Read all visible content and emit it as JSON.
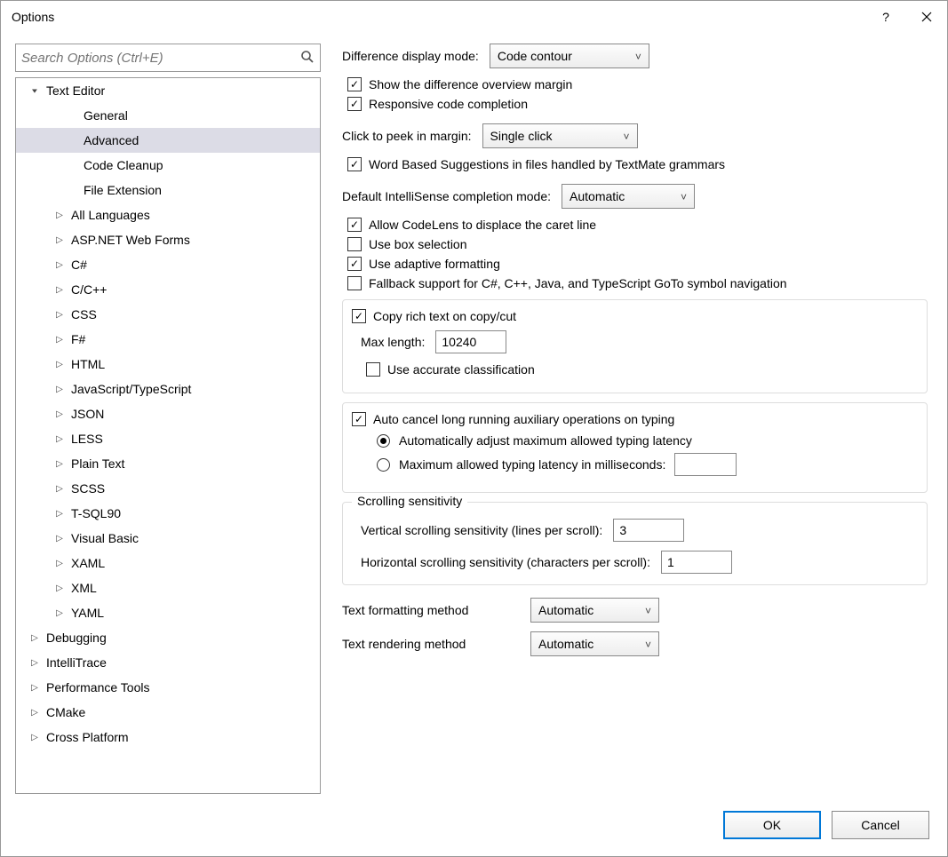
{
  "window": {
    "title": "Options"
  },
  "search": {
    "placeholder": "Search Options (Ctrl+E)"
  },
  "tree": {
    "items": [
      {
        "label": "Text Editor",
        "indent": 0,
        "caret": "open"
      },
      {
        "label": "General",
        "indent": 1,
        "caret": "none"
      },
      {
        "label": "Advanced",
        "indent": 1,
        "caret": "none",
        "selected": true
      },
      {
        "label": "Code Cleanup",
        "indent": 1,
        "caret": "none"
      },
      {
        "label": "File Extension",
        "indent": 1,
        "caret": "none"
      },
      {
        "label": "All Languages",
        "indent": 1,
        "caret": "closed"
      },
      {
        "label": "ASP.NET Web Forms",
        "indent": 1,
        "caret": "closed"
      },
      {
        "label": "C#",
        "indent": 1,
        "caret": "closed"
      },
      {
        "label": "C/C++",
        "indent": 1,
        "caret": "closed"
      },
      {
        "label": "CSS",
        "indent": 1,
        "caret": "closed"
      },
      {
        "label": "F#",
        "indent": 1,
        "caret": "closed"
      },
      {
        "label": "HTML",
        "indent": 1,
        "caret": "closed"
      },
      {
        "label": "JavaScript/TypeScript",
        "indent": 1,
        "caret": "closed"
      },
      {
        "label": "JSON",
        "indent": 1,
        "caret": "closed"
      },
      {
        "label": "LESS",
        "indent": 1,
        "caret": "closed"
      },
      {
        "label": "Plain Text",
        "indent": 1,
        "caret": "closed"
      },
      {
        "label": "SCSS",
        "indent": 1,
        "caret": "closed"
      },
      {
        "label": "T-SQL90",
        "indent": 1,
        "caret": "closed"
      },
      {
        "label": "Visual Basic",
        "indent": 1,
        "caret": "closed"
      },
      {
        "label": "XAML",
        "indent": 1,
        "caret": "closed"
      },
      {
        "label": "XML",
        "indent": 1,
        "caret": "closed"
      },
      {
        "label": "YAML",
        "indent": 1,
        "caret": "closed"
      },
      {
        "label": "Debugging",
        "indent": 0,
        "caret": "closed"
      },
      {
        "label": "IntelliTrace",
        "indent": 0,
        "caret": "closed"
      },
      {
        "label": "Performance Tools",
        "indent": 0,
        "caret": "closed"
      },
      {
        "label": "CMake",
        "indent": 0,
        "caret": "closed"
      },
      {
        "label": "Cross Platform",
        "indent": 0,
        "caret": "closed"
      }
    ]
  },
  "panel": {
    "diff_mode_label": "Difference display mode:",
    "diff_mode_value": "Code contour",
    "show_diff_margin": "Show the difference overview margin",
    "responsive_completion": "Responsive code completion",
    "click_peek_label": "Click to peek in margin:",
    "click_peek_value": "Single click",
    "word_suggestions": "Word Based Suggestions in files handled by TextMate grammars",
    "intellisense_label": "Default IntelliSense completion mode:",
    "intellisense_value": "Automatic",
    "codelens_displace": "Allow CodeLens to displace the caret line",
    "box_selection": "Use box selection",
    "adaptive_formatting": "Use adaptive formatting",
    "fallback_goto": "Fallback support for C#, C++, Java, and TypeScript GoTo symbol navigation",
    "copy_rich_text": "Copy rich text on copy/cut",
    "max_length_label": "Max length:",
    "max_length_value": "10240",
    "accurate_classification": "Use accurate classification",
    "auto_cancel": "Auto cancel long running auxiliary operations on typing",
    "auto_adjust_latency": "Automatically adjust maximum allowed typing latency",
    "max_latency_label": "Maximum allowed typing latency in milliseconds:",
    "max_latency_value": "",
    "scroll_legend": "Scrolling sensitivity",
    "vscroll_label": "Vertical scrolling sensitivity (lines per scroll):",
    "vscroll_value": "3",
    "hscroll_label": "Horizontal scrolling sensitivity (characters per scroll):",
    "hscroll_value": "1",
    "text_format_label": "Text formatting method",
    "text_format_value": "Automatic",
    "text_render_label": "Text rendering method",
    "text_render_value": "Automatic"
  },
  "footer": {
    "ok": "OK",
    "cancel": "Cancel"
  }
}
